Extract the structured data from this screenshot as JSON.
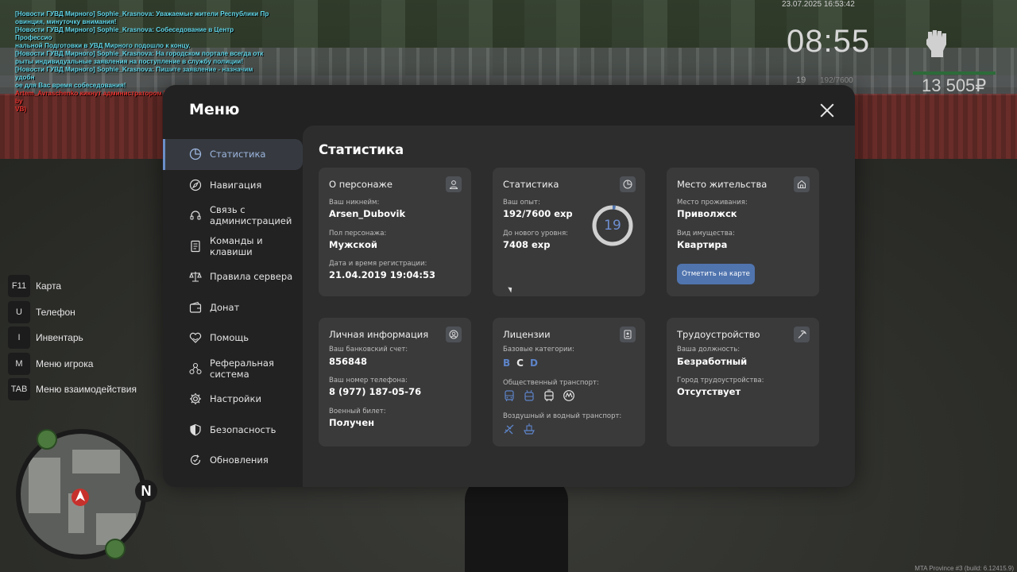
{
  "chat": [
    {
      "text": "[Новости ГУВД Мирного] Sophie_Krasnova: Уважаемые жители Республики Пр",
      "color": "cyan"
    },
    {
      "text": "овинция, минуточку внимания!",
      "color": "cyan"
    },
    {
      "text": "[Новости ГУВД Мирного] Sophie_Krasnova: Собеседование в Центр Профессио",
      "color": "cyan"
    },
    {
      "text": "нальной Подготовки в УВД Мирного подошло к концу.",
      "color": "cyan"
    },
    {
      "text": "[Новости ГУВД Мирного] Sophie_Krasnova: На городском портале всегда отк",
      "color": "cyan"
    },
    {
      "text": "рыты индивидуальные заявления на поступление в службу полиции!",
      "color": "cyan"
    },
    {
      "text": "[Новости ГУВД Мирного] Sophie_Krasnova: Пишите заявление - назначим удобн",
      "color": "cyan"
    },
    {
      "text": "ое для Вас время собеседования!",
      "color": "cyan"
    },
    {
      "text": "Artem_Avraschenko кикнут администратором Konstantin_Rodionov (AFK 30+ by",
      "color": "red"
    },
    {
      "text": " VB)",
      "color": "red"
    }
  ],
  "hud": {
    "datetime": "23.07.2025 16:53:42",
    "clock": "08:55",
    "level": "19",
    "exp": "192/7600",
    "money": "13 505₽"
  },
  "hotkeys": [
    {
      "key": "F11",
      "label": "Карта"
    },
    {
      "key": "U",
      "label": "Телефон"
    },
    {
      "key": "I",
      "label": "Инвентарь"
    },
    {
      "key": "M",
      "label": "Меню игрока"
    },
    {
      "key": "TAB",
      "label": "Меню взаимодействия"
    }
  ],
  "minimap": {
    "north": "N"
  },
  "build": "MTA Province #3 (build: 6.12415.9)",
  "menu": {
    "title": "Меню",
    "sidebar": [
      {
        "label": "Статистика",
        "icon": "pie-chart-icon",
        "active": true
      },
      {
        "label": "Навигация",
        "icon": "compass-icon"
      },
      {
        "label": "Связь с\nадминистрацией",
        "icon": "headset-icon"
      },
      {
        "label": "Команды и\nклавиши",
        "icon": "document-icon"
      },
      {
        "label": "Правила сервера",
        "icon": "scales-icon"
      },
      {
        "label": "Донат",
        "icon": "wallet-icon"
      },
      {
        "label": "Помощь",
        "icon": "heart-hands-icon"
      },
      {
        "label": "Реферальная\nсистема",
        "icon": "referral-icon"
      },
      {
        "label": "Настройки",
        "icon": "gear-icon"
      },
      {
        "label": "Безопасность",
        "icon": "shield-icon"
      },
      {
        "label": "Обновления",
        "icon": "refresh-check-icon"
      }
    ],
    "content_title": "Статистика",
    "cards": {
      "character": {
        "title": "О персонаже",
        "nick_label": "Ваш никнейм:",
        "nick": "Arsen_Dubovik",
        "gender_label": "Пол персонажа:",
        "gender": "Мужской",
        "reg_label": "Дата и время регистрации:",
        "reg": "21.04.2019 19:04:53"
      },
      "stats": {
        "title": "Статистика",
        "exp_label": "Ваш опыт:",
        "exp": "192/7600 exp",
        "next_label": "До нового уровня:",
        "next": "7408 exp",
        "level": "19",
        "level_progress": 0.025
      },
      "residence": {
        "title": "Место жительства",
        "place_label": "Место проживания:",
        "place": "Приволжск",
        "property_label": "Вид имущества:",
        "property": "Квартира",
        "button": "Отметить на карте"
      },
      "personal": {
        "title": "Личная информация",
        "bank_label": "Ваш банковский счет:",
        "bank": "856848",
        "phone_label": "Ваш номер телефона:",
        "phone": "8 (977) 187-05-76",
        "military_label": "Военный билет:",
        "military": "Получен"
      },
      "licenses": {
        "title": "Лицензии",
        "base_label": "Базовые категории:",
        "categories": [
          {
            "name": "B",
            "owned": false
          },
          {
            "name": "C",
            "owned": true
          },
          {
            "name": "D",
            "owned": false
          }
        ],
        "public_label": "Общественный транспорт:",
        "air_label": "Воздушный и водный транспорт:"
      },
      "employment": {
        "title": "Трудоустройство",
        "position_label": "Ваша должность:",
        "position": "Безработный",
        "city_label": "Город трудоустройства:",
        "city": "Отсутствует"
      }
    }
  },
  "colors": {
    "accent": "#5074ae",
    "panel": "#3a3a3b",
    "chat_cyan": "#61d6e8",
    "chat_red": "#e8332f"
  }
}
